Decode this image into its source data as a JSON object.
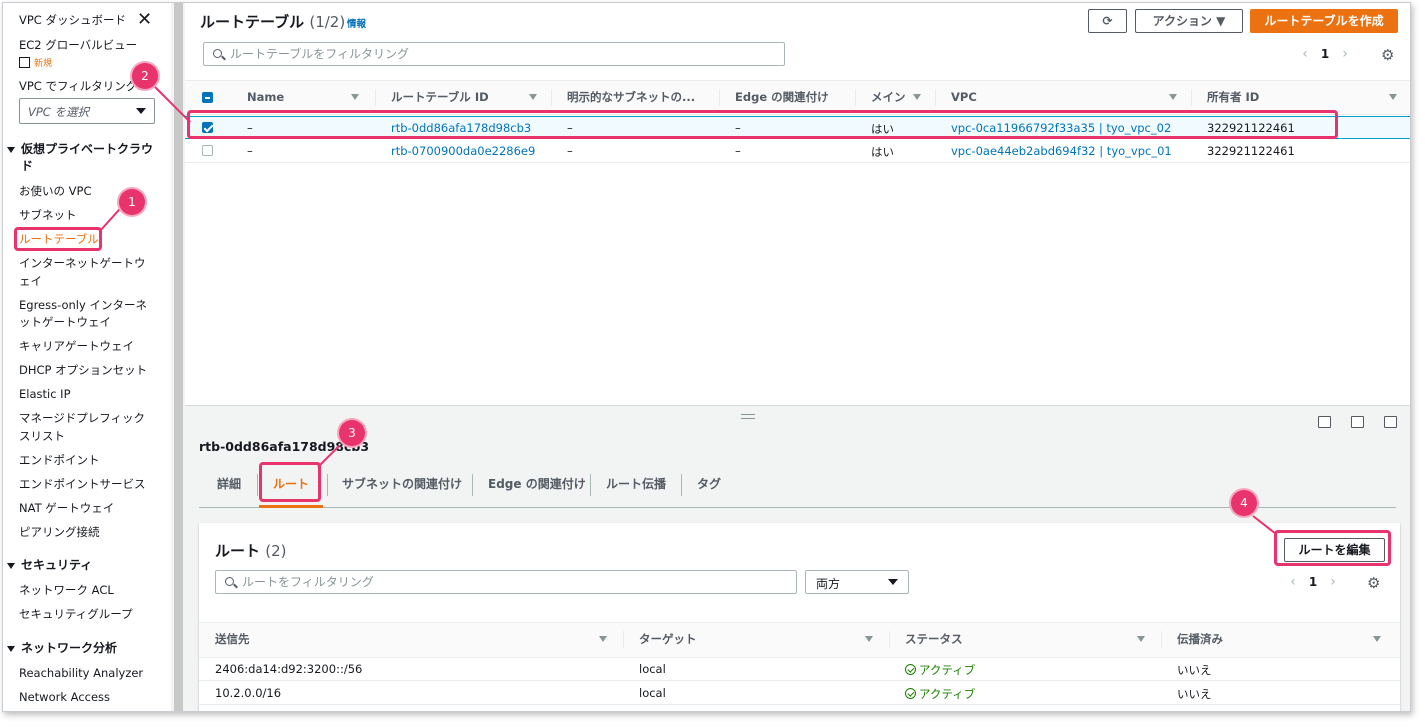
{
  "sidebar": {
    "dashboard": "VPC ダッシュボード",
    "ec2_global": "EC2 グローバルビュー",
    "new_badge": "新規",
    "filter_label": "VPC でフィルタリング:",
    "vpc_select_placeholder": "VPC を選択",
    "section_vpc": "仮想プライベートクラウ",
    "section_vpc_2": "ド",
    "items_vpc": [
      "お使いの VPC",
      "サブネット",
      "ルートテーブル",
      "インターネットゲートウ",
      "ェイ",
      "Egress-only インターネ",
      "ットゲートウェイ",
      "キャリアゲートウェイ",
      "DHCP オプションセット",
      "Elastic IP",
      "マネージドプレフィック",
      "スリスト",
      "エンドポイント",
      "エンドポイントサービス",
      "NAT ゲートウェイ",
      "ピアリング接続"
    ],
    "section_security": "セキュリティ",
    "items_security": [
      "ネットワーク ACL",
      "セキュリティグループ"
    ],
    "section_network": "ネットワーク分析",
    "items_network": [
      "Reachability Analyzer",
      "Network Access"
    ]
  },
  "header": {
    "title": "ルートテーブル",
    "count": "(1/2)",
    "info": "情報",
    "actions_label": "アクション ▼",
    "create_label": "ルートテーブルを作成",
    "search_placeholder": "ルートテーブルをフィルタリング",
    "page": "1"
  },
  "route_tables": {
    "columns": [
      "Name",
      "ルートテーブル ID",
      "明示的なサブネットの...",
      "Edge の関連付け",
      "メイン",
      "VPC",
      "所有者 ID"
    ],
    "rows": [
      {
        "name": "–",
        "id": "rtb-0dd86afa178d98cb3",
        "subnet": "–",
        "edge": "–",
        "main": "はい",
        "vpc": "vpc-0ca11966792f33a35 | tyo_vpc_02",
        "owner": "322921122461",
        "selected": true
      },
      {
        "name": "–",
        "id": "rtb-0700900da0e2286e9",
        "subnet": "–",
        "edge": "–",
        "main": "はい",
        "vpc": "vpc-0ae44eb2abd694f32 | tyo_vpc_01",
        "owner": "322921122461",
        "selected": false
      }
    ]
  },
  "detail": {
    "id": "rtb-0dd86afa178d98cb3",
    "tabs": [
      "詳細",
      "ルート",
      "サブネットの関連付け",
      "Edge の関連付け",
      "ルート伝播",
      "タグ"
    ],
    "active_tab": "ルート"
  },
  "routes": {
    "title": "ルート",
    "count": "(2)",
    "edit_label": "ルートを編集",
    "search_placeholder": "ルートをフィルタリング",
    "filter_select": "両方",
    "page": "1",
    "columns": [
      "送信先",
      "ターゲット",
      "ステータス",
      "伝播済み"
    ],
    "rows": [
      {
        "dest": "2406:da14:d92:3200::/56",
        "target": "local",
        "status": "アクティブ",
        "propagated": "いいえ"
      },
      {
        "dest": "10.2.0.0/16",
        "target": "local",
        "status": "アクティブ",
        "propagated": "いいえ"
      }
    ]
  },
  "annotations": [
    "1",
    "2",
    "3",
    "4"
  ],
  "colors": {
    "accent": "#ec7211",
    "link": "#0073bb",
    "annotation": "#e8336d",
    "success": "#1d8102"
  }
}
